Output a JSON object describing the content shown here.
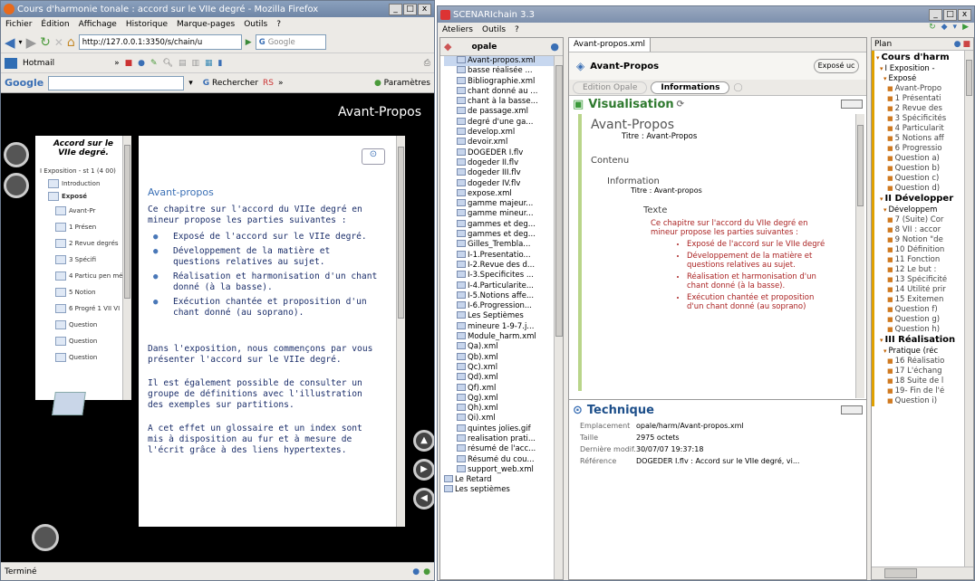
{
  "firefox": {
    "title": "Cours d'harmonie tonale : accord sur le VIIe degré - Mozilla Firefox",
    "menu": [
      "Fichier",
      "Édition",
      "Affichage",
      "Historique",
      "Marque-pages",
      "Outils",
      "?"
    ],
    "url": "http://127.0.0.1:3350/s/chain/u",
    "search_placeholder": "Google",
    "bookmarks": {
      "hotmail": "Hotmail",
      "more": "»"
    },
    "google_bar": {
      "logo": "Google",
      "search": "Rechercher",
      "rss": "RS",
      "more": "»",
      "params": "Paramètres"
    },
    "status": "Terminé"
  },
  "course": {
    "header": "Avant-Propos",
    "nav_title": "Accord sur le VIIe degré.",
    "nav": [
      {
        "label": "I Exposition - st 1 (4 00)",
        "indent": 0
      },
      {
        "label": "Introduction",
        "indent": 1
      },
      {
        "label": "Exposé",
        "indent": 1
      },
      {
        "label": "Avant-Pr",
        "indent": 2
      },
      {
        "label": "1 Présen",
        "indent": 2
      },
      {
        "label": "2 Revue degrés",
        "indent": 2
      },
      {
        "label": "3 Spécifi",
        "indent": 2
      },
      {
        "label": "4 Particu pen mé",
        "indent": 2
      },
      {
        "label": "5 Notion",
        "indent": 2
      },
      {
        "label": "6 Progré 1 VII VI",
        "indent": 2
      },
      {
        "label": "Question",
        "indent": 2
      },
      {
        "label": "Question",
        "indent": 2
      },
      {
        "label": "Question",
        "indent": 2
      }
    ],
    "content_title": "Avant-propos",
    "intro": "Ce chapitre sur l'accord du VIIe degré en mineur propose les parties suivantes :",
    "bullets": [
      "Exposé de l'accord sur le VIIe degré.",
      "Développement de la matière et questions relatives au sujet.",
      "Réalisation et harmonisation d'un chant donné (à la basse).",
      "Exécution chantée et proposition d'un chant donné (au soprano)."
    ],
    "para1": "Dans l'exposition, nous commençons par vous présenter l'accord sur le VIIe degré.",
    "para2": "Il est également possible de consulter un groupe de définitions avec l'illustration des exemples sur partitions.",
    "para3": "A cet effet un glossaire et un index sont mis à disposition au fur et à mesure de l'écrit grâce à des liens hypertextes."
  },
  "scenari": {
    "title": "SCENARIchain 3.3",
    "menu": [
      "Ateliers",
      "Outils",
      "?"
    ],
    "workshop": "opale",
    "files": [
      "Avant-propos.xml",
      "basse réalisée ...",
      "Bibliographie.xml",
      "chant donné au ...",
      "chant à la basse...",
      "de passage.xml",
      "degré d'une ga...",
      "develop.xml",
      "devoir.xml",
      "DOGEDER I.flv",
      "dogeder II.flv",
      "dogeder III.flv",
      "dogeder IV.flv",
      "expose.xml",
      "gamme majeur...",
      "gamme mineur...",
      "gammes et deg...",
      "gammes et deg...",
      "Gilles_Trembla...",
      "I-1.Presentatio...",
      "I-2.Revue des d...",
      "I-3.Specificites ...",
      "I-4.Particularite...",
      "I-5.Notions affe...",
      "I-6.Progression...",
      "Les Septièmes",
      "mineure 1-9-7.j...",
      "Module_harm.xml",
      "Qa).xml",
      "Qb).xml",
      "Qc).xml",
      "Qd).xml",
      "Qf).xml",
      "Qg).xml",
      "Qh).xml",
      "Qi).xml",
      "quintes jolies.gif",
      "realisation prati...",
      "résumé de l'acc...",
      "Résumé du cou...",
      "support_web.xml",
      "Le Retard",
      "Les septièmes"
    ],
    "editor_tab": "Avant-propos.xml",
    "doc_title": "Avant-Propos",
    "doc_badge": "Exposé uc",
    "subtabs": [
      "Edition Opale",
      "Informations"
    ],
    "vis_title": "Visualisation",
    "vis": {
      "title": "Avant-Propos",
      "titre_line": "Titre : Avant-Propos",
      "contenu": "Contenu",
      "information": "Information",
      "info_titre": "Titre : Avant-propos",
      "texte": "Texte",
      "texte_intro": "Ce chapitre sur l'accord du VIIe degré en mineur propose les parties suivantes :",
      "bullets": [
        "Exposé de l'accord sur le VIIe degré",
        "Développement de la matière et questions relatives au sujet.",
        "Réalisation et harmonisation d'un chant donné (à la basse).",
        "Exécution chantée et proposition d'un chant donné (au soprano)"
      ]
    },
    "tech_title": "Technique",
    "tech": [
      {
        "k": "Emplacement",
        "v": "opale/harm/Avant-propos.xml"
      },
      {
        "k": "Taille",
        "v": "2975 octets"
      },
      {
        "k": "Dernière modif.",
        "v": "30/07/07 19:37:18"
      },
      {
        "k": "Référence",
        "v": "DOGEDER I.flv : Accord sur le VIIe degré, vi..."
      }
    ],
    "plan_label": "Plan",
    "plan": [
      {
        "t": "Cours d'harm",
        "lvl": 0,
        "b": true
      },
      {
        "t": "I Exposition -",
        "lvl": 1,
        "b": false
      },
      {
        "t": "Exposé",
        "lvl": 2,
        "b": false
      },
      {
        "t": "Avant-Propo",
        "lvl": 3,
        "b": false
      },
      {
        "t": "1 Présentati",
        "lvl": 3,
        "b": false
      },
      {
        "t": "2 Revue des",
        "lvl": 3,
        "b": false
      },
      {
        "t": "3 Spécificités",
        "lvl": 3,
        "b": false
      },
      {
        "t": "4 Particularit",
        "lvl": 3,
        "b": false
      },
      {
        "t": "5 Notions aff",
        "lvl": 3,
        "b": false
      },
      {
        "t": "6 Progressio",
        "lvl": 3,
        "b": false
      },
      {
        "t": "Question a)",
        "lvl": 3,
        "b": false
      },
      {
        "t": "Question b)",
        "lvl": 3,
        "b": false
      },
      {
        "t": "Question c)",
        "lvl": 3,
        "b": false
      },
      {
        "t": "Question d)",
        "lvl": 3,
        "b": false
      },
      {
        "t": "II Développer",
        "lvl": 1,
        "b": true
      },
      {
        "t": "Développem",
        "lvl": 2,
        "b": false
      },
      {
        "t": "7 (Suite) Cor",
        "lvl": 3,
        "b": false
      },
      {
        "t": "8 VII : accor",
        "lvl": 3,
        "b": false
      },
      {
        "t": "9 Notion \"de",
        "lvl": 3,
        "b": false
      },
      {
        "t": "10 Définition",
        "lvl": 3,
        "b": false
      },
      {
        "t": "11 Fonction",
        "lvl": 3,
        "b": false
      },
      {
        "t": "12 Le but :",
        "lvl": 3,
        "b": false
      },
      {
        "t": "13 Spécificité",
        "lvl": 3,
        "b": false
      },
      {
        "t": "14 Utilité prir",
        "lvl": 3,
        "b": false
      },
      {
        "t": "15 Exitemen",
        "lvl": 3,
        "b": false
      },
      {
        "t": "Question f)",
        "lvl": 3,
        "b": false
      },
      {
        "t": "Question g)",
        "lvl": 3,
        "b": false
      },
      {
        "t": "Question h)",
        "lvl": 3,
        "b": false
      },
      {
        "t": "III Réalisation",
        "lvl": 1,
        "b": true
      },
      {
        "t": "Pratique (réc",
        "lvl": 2,
        "b": false
      },
      {
        "t": "16 Réalisatio",
        "lvl": 3,
        "b": false
      },
      {
        "t": "17 L'échang",
        "lvl": 3,
        "b": false
      },
      {
        "t": "18 Suite de l",
        "lvl": 3,
        "b": false
      },
      {
        "t": "19- Fin de l'é",
        "lvl": 3,
        "b": false
      },
      {
        "t": "Question i)",
        "lvl": 3,
        "b": false
      }
    ]
  }
}
